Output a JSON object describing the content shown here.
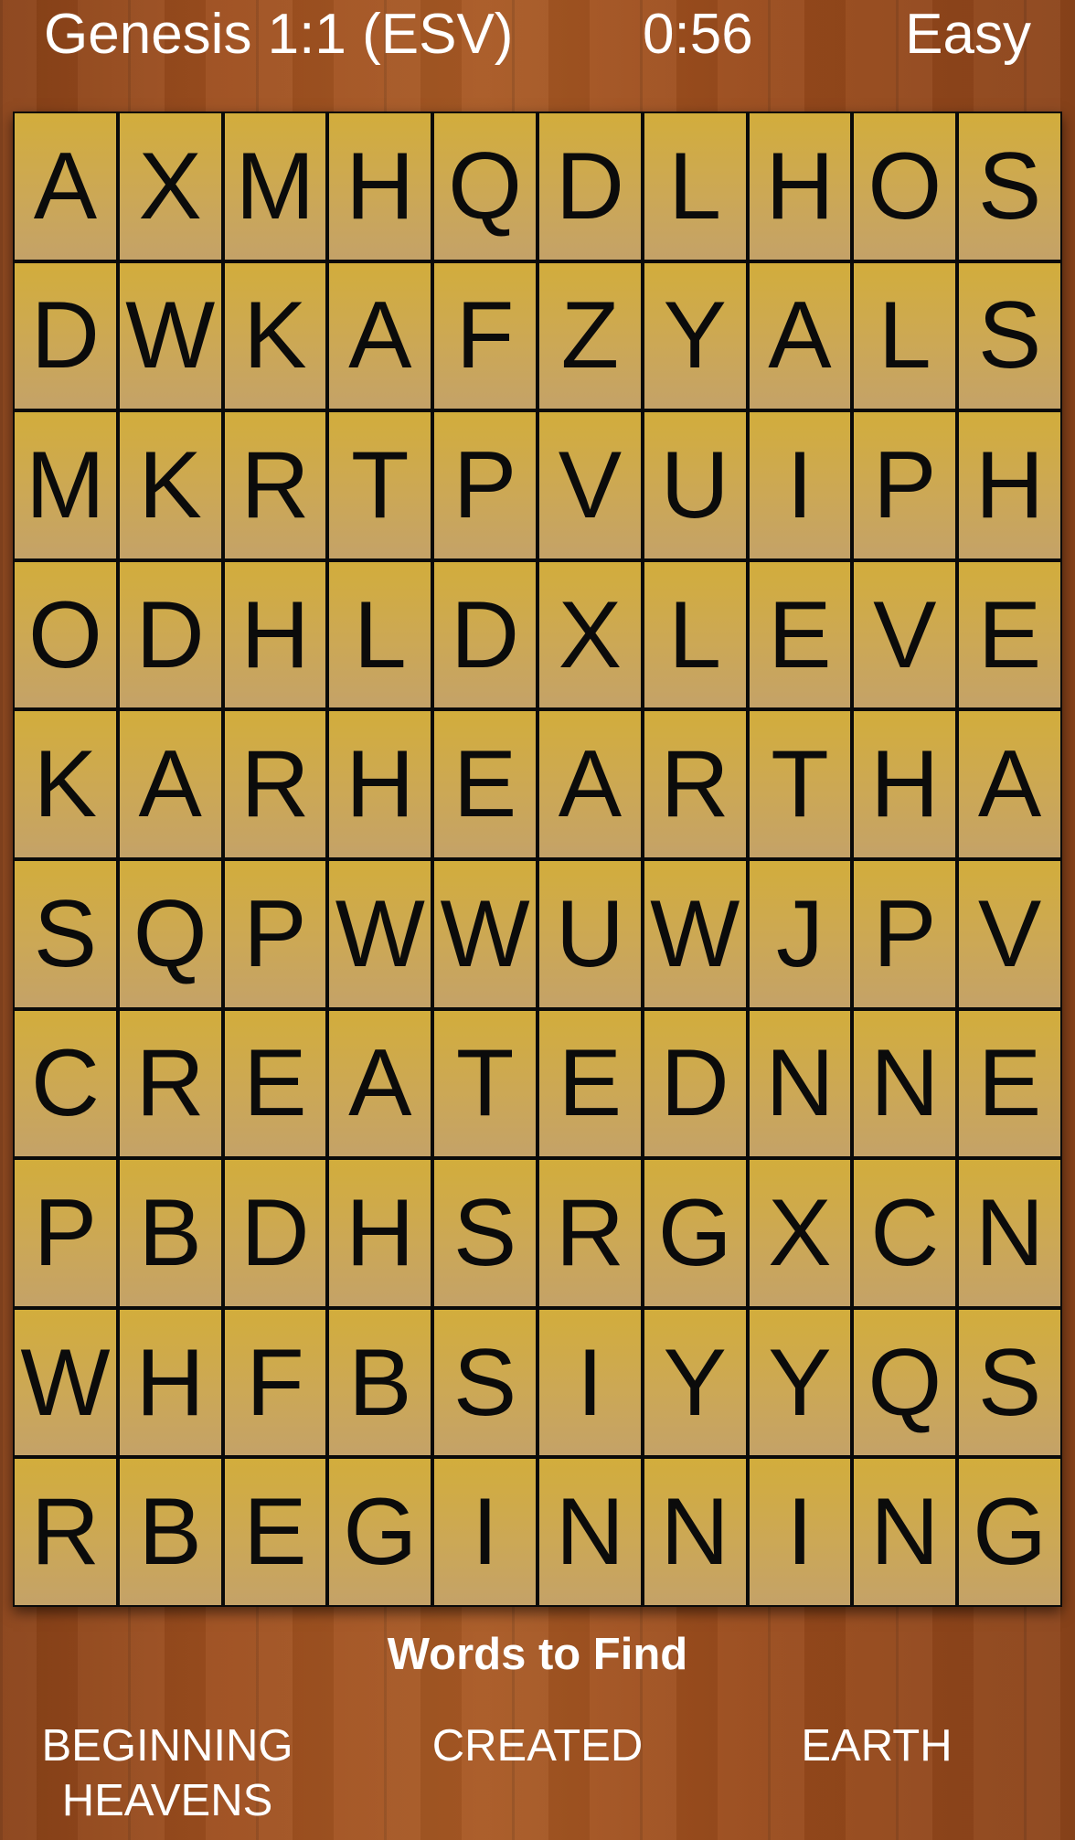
{
  "header": {
    "title": "Genesis 1:1 (ESV)",
    "timer": "0:56",
    "difficulty": "Easy"
  },
  "grid": [
    [
      "A",
      "X",
      "M",
      "H",
      "Q",
      "D",
      "L",
      "H",
      "O",
      "S"
    ],
    [
      "D",
      "W",
      "K",
      "A",
      "F",
      "Z",
      "Y",
      "A",
      "L",
      "S"
    ],
    [
      "M",
      "K",
      "R",
      "T",
      "P",
      "V",
      "U",
      "I",
      "P",
      "H"
    ],
    [
      "O",
      "D",
      "H",
      "L",
      "D",
      "X",
      "L",
      "E",
      "V",
      "E"
    ],
    [
      "K",
      "A",
      "R",
      "H",
      "E",
      "A",
      "R",
      "T",
      "H",
      "A"
    ],
    [
      "S",
      "Q",
      "P",
      "W",
      "W",
      "U",
      "W",
      "J",
      "P",
      "V"
    ],
    [
      "C",
      "R",
      "E",
      "A",
      "T",
      "E",
      "D",
      "N",
      "N",
      "E"
    ],
    [
      "P",
      "B",
      "D",
      "H",
      "S",
      "R",
      "G",
      "X",
      "C",
      "N"
    ],
    [
      "W",
      "H",
      "F",
      "B",
      "S",
      "I",
      "Y",
      "Y",
      "Q",
      "S"
    ],
    [
      "R",
      "B",
      "E",
      "G",
      "I",
      "N",
      "N",
      "I",
      "N",
      "G"
    ]
  ],
  "words_section": {
    "title": "Words to Find",
    "words": [
      "BEGINNING",
      "CREATED",
      "EARTH",
      "HEAVENS"
    ]
  }
}
